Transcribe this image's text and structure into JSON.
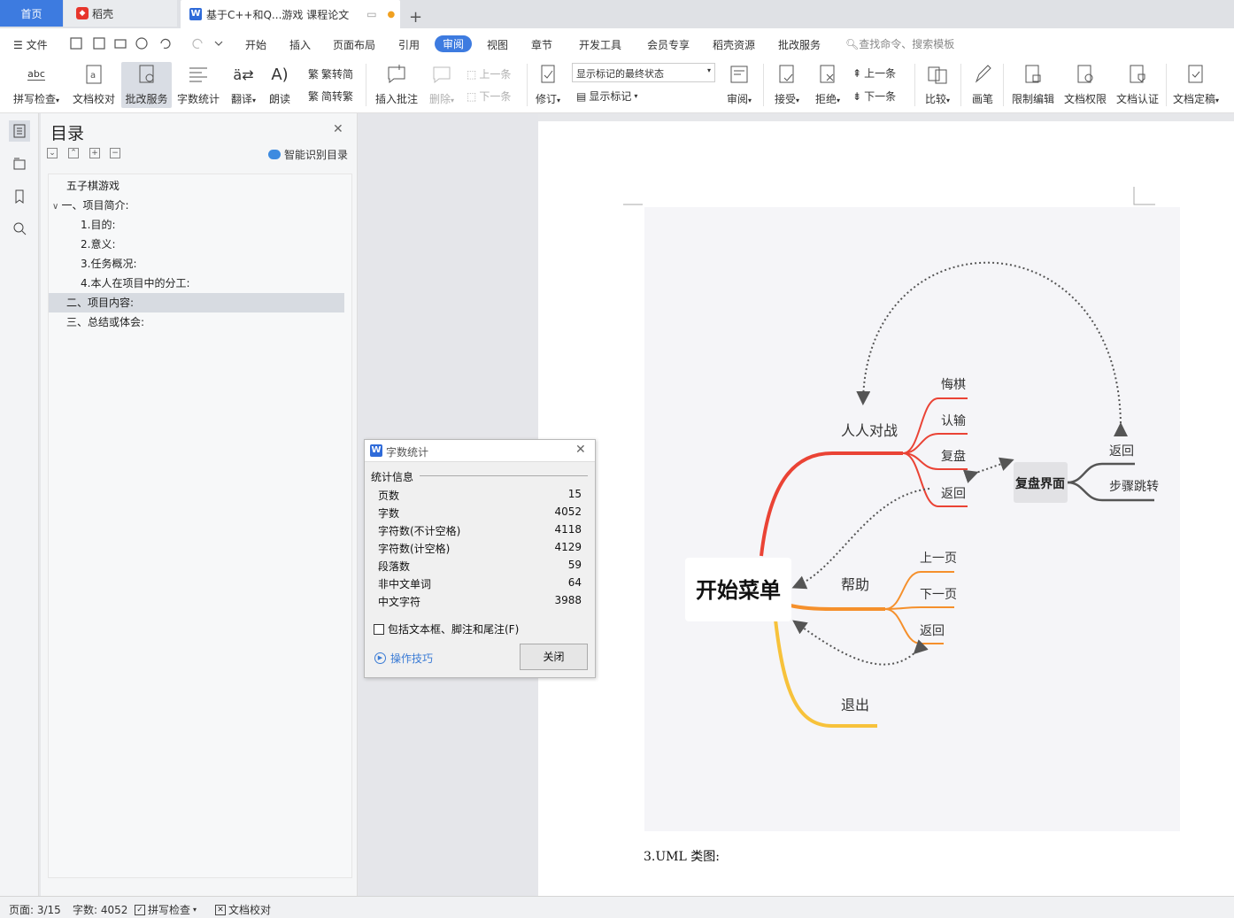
{
  "tabs": {
    "home": "首页",
    "daoke": "稻壳",
    "doc": "基于C++和Q...游戏 课程论文",
    "add": "+"
  },
  "menu": {
    "file": "文件",
    "items": [
      "开始",
      "插入",
      "页面布局",
      "引用",
      "审阅",
      "视图",
      "章节",
      "开发工具",
      "会员专享",
      "稻壳资源",
      "批改服务"
    ],
    "search": "查找命令、搜索模板"
  },
  "ribbon": {
    "spellcheck": "拼写检查",
    "proofread": "文档校对",
    "pigai": "批改服务",
    "wordcount": "字数统计",
    "translate": "翻译",
    "readaloud": "朗读",
    "trad": "繁转简",
    "simp": "简转繁",
    "insert_comment": "插入批注",
    "delete": "删除",
    "prev_comment": "上一条",
    "next_comment": "下一条",
    "revise": "修订",
    "markup_state": "显示标记的最终状态",
    "show_markup": "显示标记",
    "review": "审阅",
    "accept": "接受",
    "reject": "拒绝",
    "prev_change": "上一条",
    "next_change": "下一条",
    "compare": "比较",
    "pen": "画笔",
    "restrict": "限制编辑",
    "permission": "文档权限",
    "certify": "文档认证",
    "finalize": "文档定稿"
  },
  "toc": {
    "title": "目录",
    "smart": "智能识别目录",
    "items": [
      {
        "text": "五子棋游戏"
      },
      {
        "text": "一、项目简介:"
      },
      {
        "text": "1.目的:"
      },
      {
        "text": "2.意义:"
      },
      {
        "text": "3.任务概况:"
      },
      {
        "text": "4.本人在项目中的分工:"
      },
      {
        "text": "二、项目内容:"
      },
      {
        "text": "三、总结或体会:"
      }
    ]
  },
  "mindmap": {
    "root": "开始菜单",
    "pvp": "人人对战",
    "undo": "悔棋",
    "surrender": "认输",
    "replay": "复盘",
    "back1": "返回",
    "help": "帮助",
    "prev_page": "上一页",
    "next_page": "下一页",
    "back2": "返回",
    "exit": "退出",
    "replay_screen": "复盘界面",
    "back3": "返回",
    "step_jump": "步骤跳转",
    "colors": {
      "red": "#ea4335",
      "orange": "#f5902c",
      "yellow": "#f7c23b",
      "gray": "#555555"
    }
  },
  "caption": "3.UML 类图:",
  "dialog": {
    "title": "字数统计",
    "section": "统计信息",
    "rows": [
      {
        "label": "页数",
        "value": "15"
      },
      {
        "label": "字数",
        "value": "4052"
      },
      {
        "label": "字符数(不计空格)",
        "value": "4118"
      },
      {
        "label": "字符数(计空格)",
        "value": "4129"
      },
      {
        "label": "段落数",
        "value": "59"
      },
      {
        "label": "非中文单词",
        "value": "64"
      },
      {
        "label": "中文字符",
        "value": "3988"
      }
    ],
    "include": "包括文本框、脚注和尾注(F)",
    "tips": "操作技巧",
    "close": "关闭"
  },
  "status": {
    "page": "页面: 3/15",
    "words": "字数: 4052",
    "spell": "拼写检查",
    "proof": "文档校对"
  }
}
